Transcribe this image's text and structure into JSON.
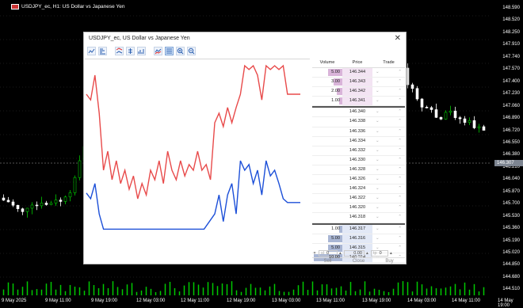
{
  "chart": {
    "symbol_title": "USDJPY_ec, H1:  US Dollar vs Japanese Yen",
    "price_axis": [
      "148.590",
      "148.520",
      "148.250",
      "147.910",
      "147.740",
      "147.570",
      "147.400",
      "147.230",
      "147.060",
      "146.890",
      "146.720",
      "146.550",
      "146.380",
      "146.210",
      "146.040",
      "145.870",
      "145.700",
      "145.530",
      "145.360",
      "145.190",
      "145.020",
      "144.850",
      "144.680",
      "144.510"
    ],
    "current_price": "146.307",
    "time_axis": [
      "9 May 2025",
      "9 May 11:00",
      "9 May 19:00",
      "12 May 03:00",
      "12 May 11:00",
      "12 May 19:00",
      "13 May 03:00",
      "13 May 11:00",
      "13 May 19:00",
      "14 May 03:00",
      "14 May 11:00",
      "14 May 19:00"
    ],
    "colors": {
      "bull": "#00c800",
      "bear": "#ffffff",
      "background": "#000000"
    }
  },
  "dialog": {
    "title": "USDJPY_ec, US Dollar vs Japanese Yen",
    "close_icon": "close-icon",
    "toolbar": [
      {
        "name": "tick-chart-icon",
        "selected": false
      },
      {
        "name": "depth-icon",
        "selected": false
      },
      {
        "name": "bid-ask-icon",
        "selected": false
      },
      {
        "name": "spread-icon",
        "selected": false
      },
      {
        "name": "volume-icon",
        "selected": false
      },
      {
        "name": "ticks-icon",
        "selected": false
      },
      {
        "name": "lines-icon",
        "selected": false
      },
      {
        "name": "zoom-in-icon",
        "selected": false
      },
      {
        "name": "zoom-out-icon",
        "selected": false
      }
    ],
    "tick_chart": {
      "ask_color": "#e84a4a",
      "bid_color": "#1c4fd8"
    },
    "dom": {
      "headers": {
        "volume": "Volume",
        "price": "Price",
        "trade": "Trade"
      },
      "rows": [
        {
          "vol": "5.00",
          "price": "146.344",
          "side": "ask"
        },
        {
          "vol": "3.00",
          "price": "146.343",
          "side": "ask"
        },
        {
          "vol": "2.00",
          "price": "146.342",
          "side": "ask"
        },
        {
          "vol": "1.00",
          "price": "146.341",
          "side": "ask"
        },
        {
          "vol": "",
          "price": "146.340",
          "side": "none"
        },
        {
          "vol": "",
          "price": "146.338",
          "side": "none"
        },
        {
          "vol": "",
          "price": "146.336",
          "side": "none"
        },
        {
          "vol": "",
          "price": "146.334",
          "side": "none"
        },
        {
          "vol": "",
          "price": "146.332",
          "side": "none"
        },
        {
          "vol": "",
          "price": "146.330",
          "side": "none"
        },
        {
          "vol": "",
          "price": "146.328",
          "side": "none"
        },
        {
          "vol": "",
          "price": "146.326",
          "side": "none"
        },
        {
          "vol": "",
          "price": "146.324",
          "side": "none"
        },
        {
          "vol": "",
          "price": "146.322",
          "side": "none"
        },
        {
          "vol": "",
          "price": "146.320",
          "side": "none"
        },
        {
          "vol": "",
          "price": "146.318",
          "side": "none"
        },
        {
          "vol": "1.00",
          "price": "146.317",
          "side": "bid"
        },
        {
          "vol": "5.00",
          "price": "146.316",
          "side": "bid"
        },
        {
          "vol": "5.00",
          "price": "146.315",
          "side": "bid"
        },
        {
          "vol": "10.00",
          "price": "146.314",
          "side": "bid"
        }
      ],
      "volume_spinner": "0",
      "sl_spinner": "0.00",
      "tp_spinner": "0",
      "sell_label": "Sell",
      "close_label": "Close",
      "buy_label": "Buy"
    }
  }
}
